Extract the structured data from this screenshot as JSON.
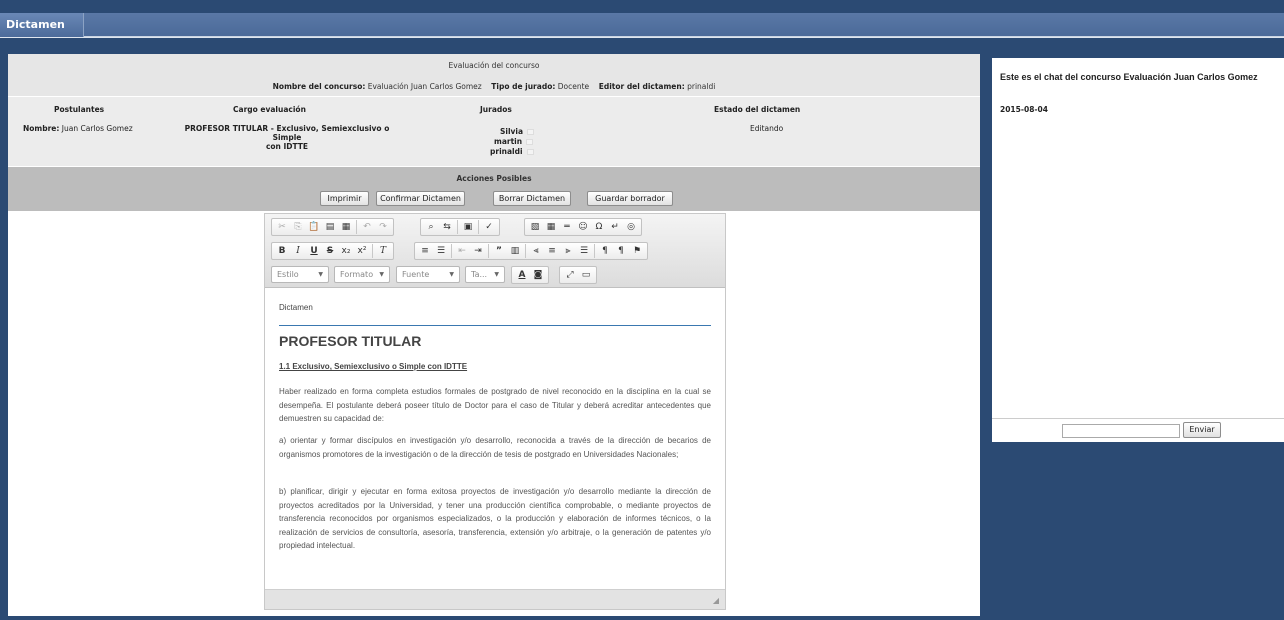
{
  "window": {
    "title": "Dictamen"
  },
  "header": {
    "heading": "Evaluación del concurso",
    "concurso_label": "Nombre del concurso:",
    "concurso_value": "Evaluación Juan Carlos Gomez",
    "tipo_label": "Tipo de jurado:",
    "tipo_value": "Docente",
    "editor_label": "Editor del dictamen:",
    "editor_value": "prinaldi"
  },
  "columns": {
    "postulantes": "Postulantes",
    "cargo": "Cargo evaluación",
    "jurados": "Jurados",
    "estado": "Estado del dictamen"
  },
  "row": {
    "nombre_label": "Nombre:",
    "nombre_value": "Juan Carlos Gomez",
    "cargo_line1": "PROFESOR TITULAR - Exclusivo, Semiexclusivo o Simple",
    "cargo_line2": "con IDTTE",
    "jurados": [
      "Silvia",
      "martin",
      "prinaldi"
    ],
    "estado": "Editando"
  },
  "actions": {
    "title": "Acciones Posibles",
    "buttons": [
      "Imprimir",
      "Confirmar Dictamen",
      "Borrar Dictamen",
      "Guardar borrador"
    ]
  },
  "editor": {
    "toolbar_row1": [
      "cut-icon",
      "copy-icon",
      "paste-icon",
      "paste-text-icon",
      "paste-word-icon",
      "undo-icon",
      "redo-icon",
      "find-icon",
      "replace-icon",
      "select-all-icon",
      "spellcheck-icon",
      "image-icon",
      "table-icon",
      "horizontal-rule-icon",
      "smiley-icon",
      "special-char-icon",
      "page-break-icon",
      "iframe-icon"
    ],
    "toolbar_row2": [
      "bold-icon",
      "italic-icon",
      "underline-icon",
      "strike-icon",
      "subscript-icon",
      "superscript-icon",
      "remove-format-icon",
      "numbered-list-icon",
      "bulleted-list-icon",
      "outdent-icon",
      "indent-icon",
      "blockquote-icon",
      "div-icon",
      "align-left-icon",
      "align-center-icon",
      "align-right-icon",
      "justify-icon",
      "ltr-icon",
      "rtl-icon",
      "language-icon"
    ],
    "combos": {
      "estilo": "Estilo",
      "formato": "Formato",
      "fuente": "Fuente",
      "tamano": "Ta..."
    },
    "doc_header": "Dictamen",
    "heading": "PROFESOR TITULAR",
    "subheading": "1.1 Exclusivo,  Semiexclusivo  o Simple  con IDTTE",
    "paragraphs": [
      "Haber realizado en forma completa estudios formales de postgrado de nivel reconocido en la disciplina en la cual se desempeña. El postulante deberá poseer título de Doctor para el caso de Titular y deberá acreditar antecedentes que demuestren su capacidad de:",
      "a) orientar y formar discípulos en investigación y/o desarrollo, reconocida a través de la dirección de becarios de organismos promotores de la investigación o de la dirección de tesis de postgrado en Universidades Nacionales;",
      "b) planificar, dirigir y ejecutar en forma exitosa proyectos de investigación y/o desarrollo mediante la dirección de proyectos acreditados por la Universidad, y tener una producción científica comprobable, o mediante proyectos de transferencia reconocidos por organismos especializados, o la producción y elaboración de informes técnicos, o la realización de servicios de consultoría, asesoría, transferencia, extensión y/o arbitraje, o la generación de patentes y/o propiedad intelectual."
    ]
  },
  "chat": {
    "title": "Este es el chat del concurso Evaluación Juan Carlos Gomez",
    "date": "2015-08-04",
    "input_value": "",
    "send_label": "Enviar"
  }
}
